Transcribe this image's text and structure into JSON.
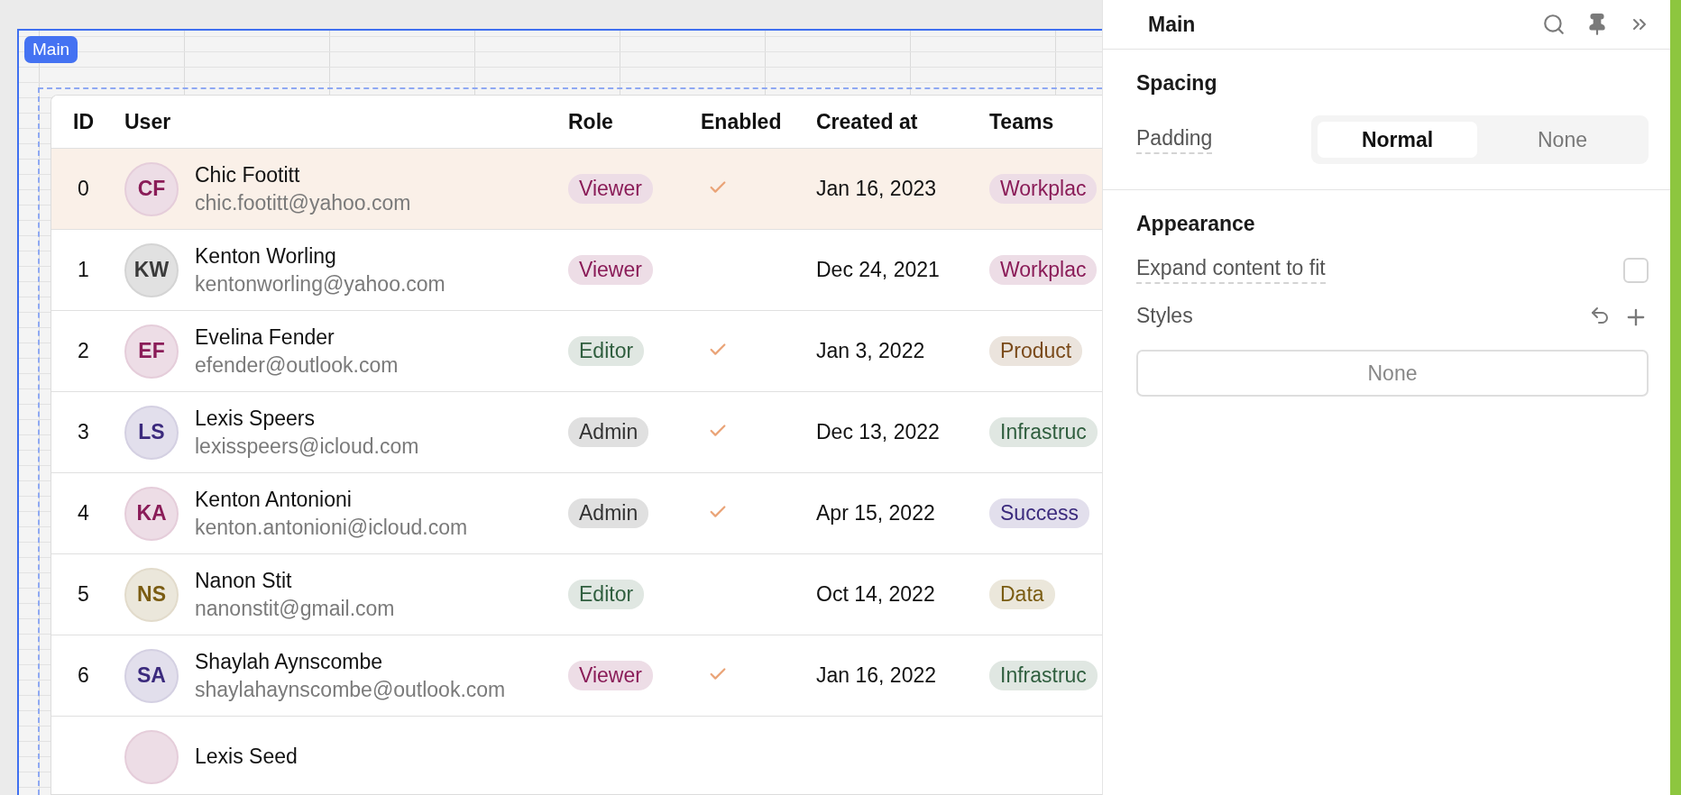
{
  "canvas": {
    "frame_label": "Main"
  },
  "table": {
    "columns": [
      "ID",
      "User",
      "Role",
      "Enabled",
      "Created at",
      "Teams"
    ],
    "rows": [
      {
        "id": "0",
        "name": "Chic Footitt",
        "email": "chic.footitt@yahoo.com",
        "avatar": {
          "initials": "CF",
          "color": "#8a1c58"
        },
        "role": {
          "label": "Viewer",
          "color": "#8a1c58"
        },
        "enabled": true,
        "created": "Jan 16, 2023",
        "team": {
          "label": "Workplac",
          "color": "#8a1c58"
        },
        "selected": true
      },
      {
        "id": "1",
        "name": "Kenton Worling",
        "email": "kentonworling@yahoo.com",
        "avatar": {
          "initials": "KW",
          "color": "#3a3a3a"
        },
        "role": {
          "label": "Viewer",
          "color": "#8a1c58"
        },
        "enabled": false,
        "created": "Dec 24, 2021",
        "team": {
          "label": "Workplac",
          "color": "#8a1c58"
        },
        "selected": false
      },
      {
        "id": "2",
        "name": "Evelina Fender",
        "email": "efender@outlook.com",
        "avatar": {
          "initials": "EF",
          "color": "#8a1c58"
        },
        "role": {
          "label": "Editor",
          "color": "#2f5e3e"
        },
        "enabled": true,
        "created": "Jan 3, 2022",
        "team": {
          "label": "Product",
          "color": "#7a4a1a"
        },
        "selected": false
      },
      {
        "id": "3",
        "name": "Lexis Speers",
        "email": "lexisspeers@icloud.com",
        "avatar": {
          "initials": "LS",
          "color": "#3b2a7d"
        },
        "role": {
          "label": "Admin",
          "color": "#333333"
        },
        "enabled": true,
        "created": "Dec 13, 2022",
        "team": {
          "label": "Infrastruc",
          "color": "#2f5e3e"
        },
        "selected": false
      },
      {
        "id": "4",
        "name": "Kenton Antonioni",
        "email": "kenton.antonioni@icloud.com",
        "avatar": {
          "initials": "KA",
          "color": "#8a1c58"
        },
        "role": {
          "label": "Admin",
          "color": "#333333"
        },
        "enabled": true,
        "created": "Apr 15, 2022",
        "team": {
          "label": "Success",
          "color": "#3b2a7d"
        },
        "selected": false
      },
      {
        "id": "5",
        "name": "Nanon Stit",
        "email": "nanonstit@gmail.com",
        "avatar": {
          "initials": "NS",
          "color": "#7a5c12"
        },
        "role": {
          "label": "Editor",
          "color": "#2f5e3e"
        },
        "enabled": false,
        "created": "Oct 14, 2022",
        "team": {
          "label": "Data",
          "color": "#7a5c12"
        },
        "selected": false
      },
      {
        "id": "6",
        "name": "Shaylah Aynscombe",
        "email": "shaylahaynscombe@outlook.com",
        "avatar": {
          "initials": "SA",
          "color": "#3b2a7d"
        },
        "role": {
          "label": "Viewer",
          "color": "#8a1c58"
        },
        "enabled": true,
        "created": "Jan 16, 2022",
        "team": {
          "label": "Infrastruc",
          "color": "#2f5e3e"
        },
        "selected": false
      },
      {
        "name": "Lexis Seed",
        "selected": false
      }
    ]
  },
  "panel": {
    "title": "Main",
    "spacing": {
      "heading": "Spacing",
      "padding_label": "Padding",
      "options": [
        {
          "label": "Normal",
          "selected": true
        },
        {
          "label": "None",
          "selected": false
        }
      ]
    },
    "appearance": {
      "heading": "Appearance",
      "expand_label": "Expand content to fit",
      "expand_checked": false,
      "styles_label": "Styles",
      "styles_value": "None"
    }
  }
}
